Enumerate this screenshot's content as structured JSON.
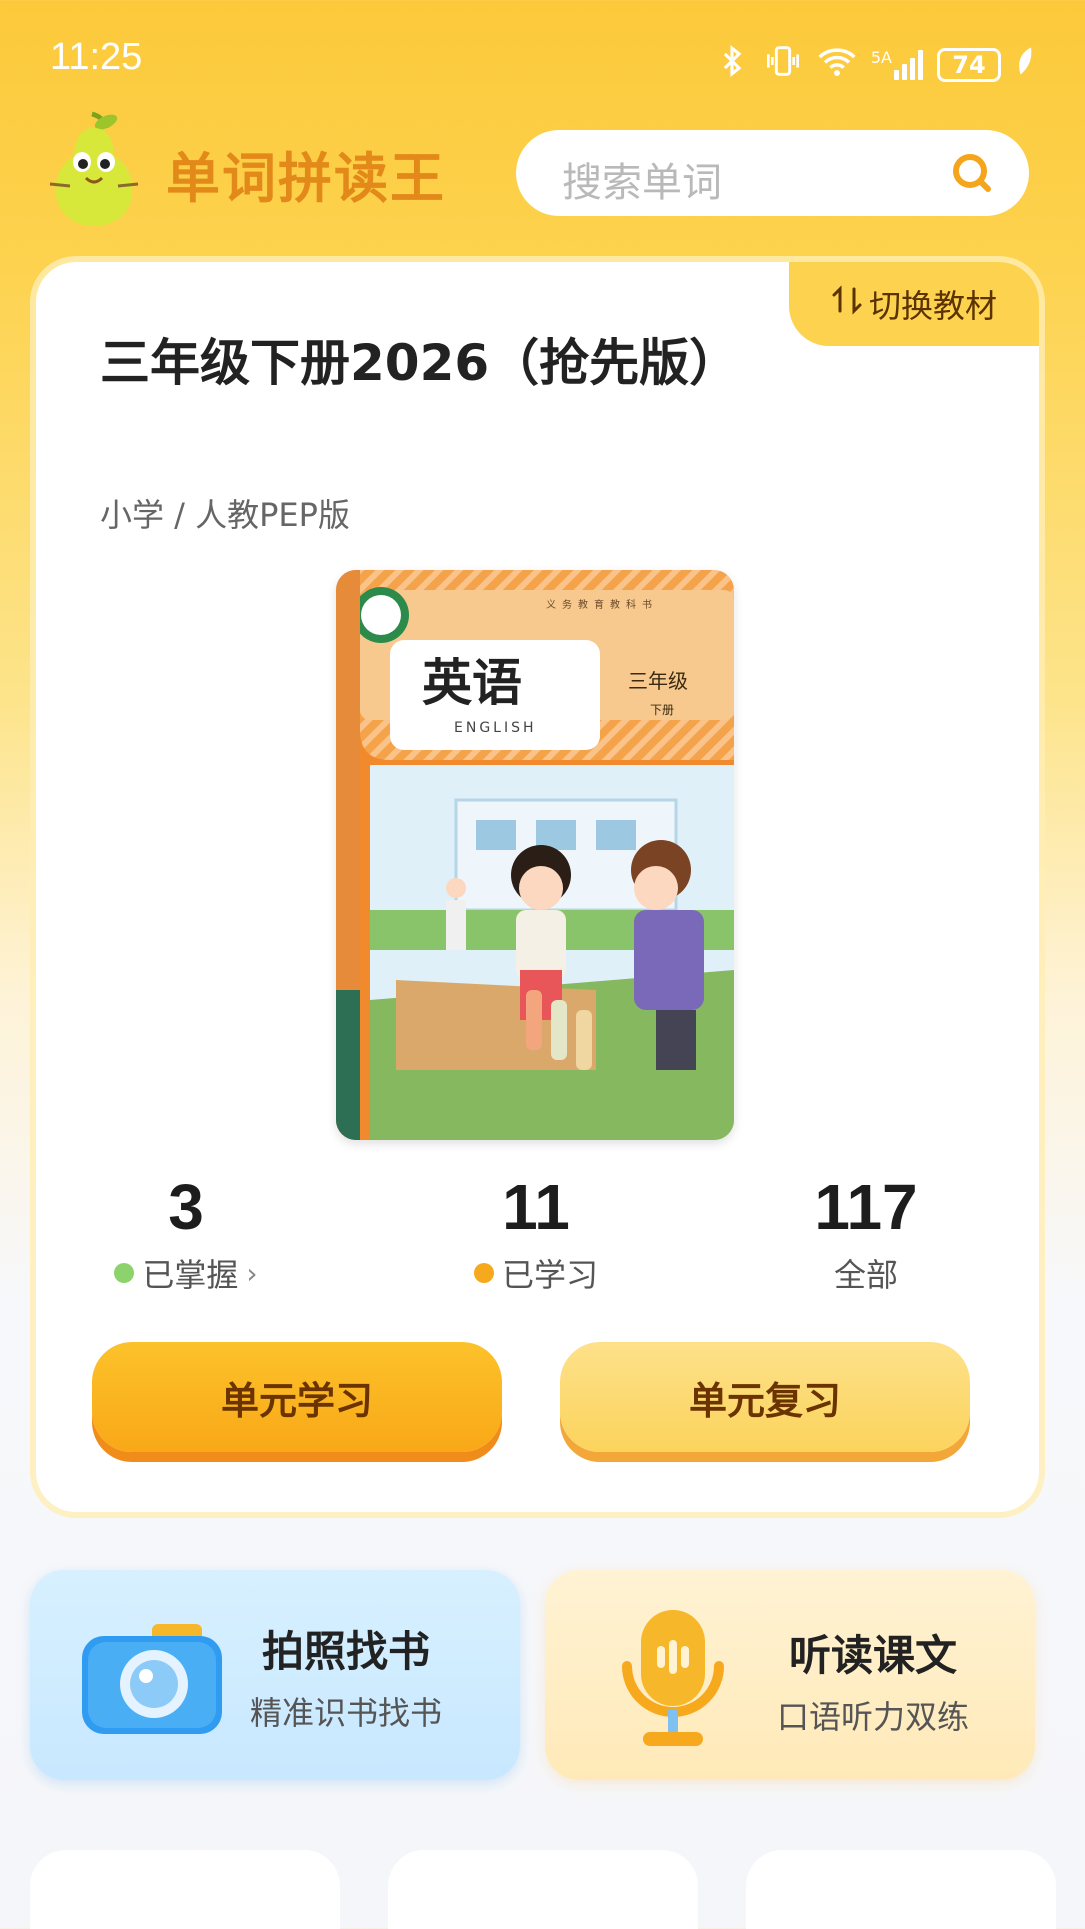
{
  "status": {
    "time": "11:25",
    "battery": "74",
    "network": "5A"
  },
  "header": {
    "app_name": "单词拼读王",
    "search_placeholder": "搜索单词"
  },
  "book": {
    "switch_label": "切换教材",
    "title": "三年级下册2026（抢先版）",
    "subtitle": "小学 / 人教PEP版",
    "cover": {
      "series": "义务教育教科书",
      "subject": "英语",
      "subject_en": "ENGLISH",
      "grade": "三年级",
      "volume": "下册"
    }
  },
  "stats": [
    {
      "value": "3",
      "label": "已掌握",
      "color": "#8cd36e",
      "arrow": "›"
    },
    {
      "value": "11",
      "label": "已学习",
      "color": "#f6a91c"
    },
    {
      "value": "117",
      "label": "全部"
    }
  ],
  "buttons": {
    "learn": "单元学习",
    "review": "单元复习"
  },
  "features": [
    {
      "title": "拍照找书",
      "subtitle": "精准识书找书",
      "icon": "camera-icon"
    },
    {
      "title": "听读课文",
      "subtitle": "口语听力双练",
      "icon": "microphone-icon"
    }
  ],
  "colors": {
    "brand": "#fcc93a",
    "accent_text": "#e2891a",
    "button_text": "#6a3300"
  }
}
